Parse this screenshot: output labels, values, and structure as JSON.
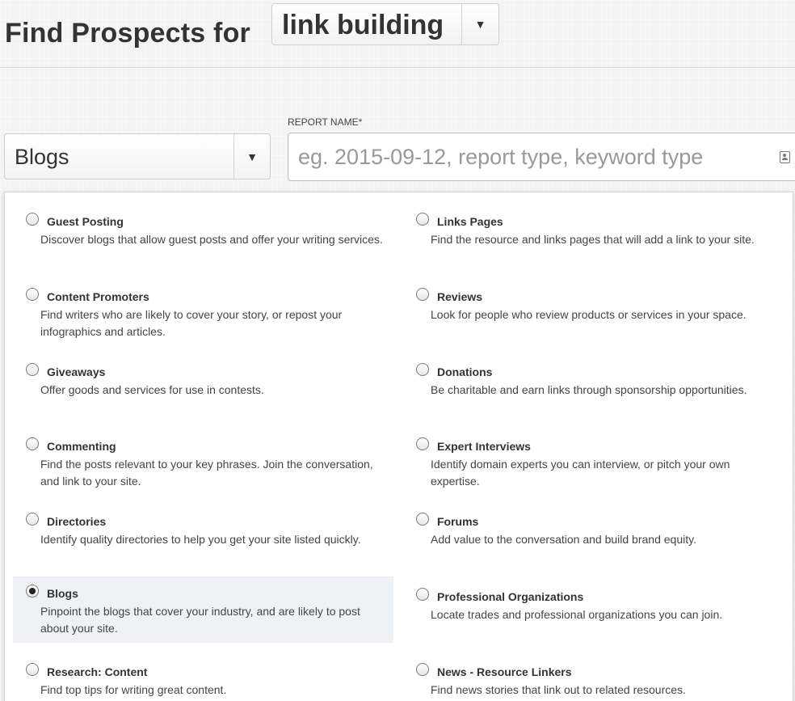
{
  "header": {
    "title": "Find Prospects for",
    "topic_select": {
      "value": "link building"
    }
  },
  "prospect_type_select": {
    "value": "Blogs"
  },
  "report_name": {
    "label": "REPORT NAME*",
    "value": "",
    "placeholder": "eg. 2015-09-12, report type, keyword type"
  },
  "options": [
    {
      "title": "Guest Posting",
      "description": "Discover blogs that allow guest posts and offer your writing services.",
      "selected": false
    },
    {
      "title": "Links Pages",
      "description": "Find the resource and links pages that will add a link to your site.",
      "selected": false
    },
    {
      "title": "Content Promoters",
      "description": "Find writers who are likely to cover your story, or repost your infographics and articles.",
      "selected": false
    },
    {
      "title": "Reviews",
      "description": "Look for people who review products or services in your space.",
      "selected": false
    },
    {
      "title": "Giveaways",
      "description": "Offer goods and services for use in contests.",
      "selected": false
    },
    {
      "title": "Donations",
      "description": "Be charitable and earn links through sponsorship opportunities.",
      "selected": false
    },
    {
      "title": "Commenting",
      "description": "Find the posts relevant to your key phrases. Join the conversation, and link to your site.",
      "selected": false
    },
    {
      "title": "Expert Interviews",
      "description": "Identify domain experts you can interview, or pitch your own expertise.",
      "selected": false
    },
    {
      "title": "Directories",
      "description": "Identify quality directories to help you get your site listed quickly.",
      "selected": false
    },
    {
      "title": "Forums",
      "description": "Add value to the conversation and build brand equity.",
      "selected": false
    },
    {
      "title": "Blogs",
      "description": "Pinpoint the blogs that cover your industry, and are likely to post about your site.",
      "selected": true
    },
    {
      "title": "Professional Organizations",
      "description": "Locate trades and professional organizations you can join.",
      "selected": false
    },
    {
      "title": "Research: Content",
      "description": "Find top tips for writing great content.",
      "selected": false
    },
    {
      "title": "News - Resource Linkers",
      "description": "Find news stories that link out to related resources.",
      "selected": false
    }
  ]
}
